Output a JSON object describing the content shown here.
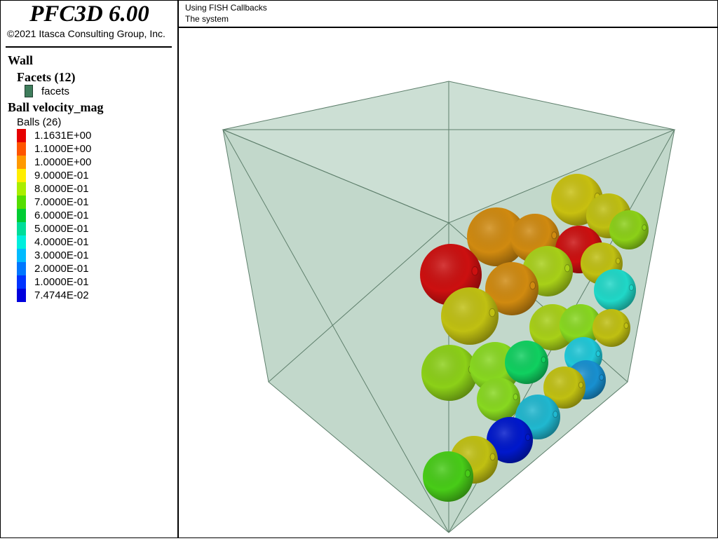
{
  "app": {
    "title": "PFC3D 6.00",
    "copyright": "©2021 Itasca Consulting Group, Inc."
  },
  "legend": {
    "wall_heading": "Wall",
    "facets_heading": "Facets (12)",
    "facet_label": "facets",
    "facet_color": "#3f7d5c",
    "ball_heading": "Ball velocity_mag",
    "balls_count": "Balls (26)",
    "scale": [
      {
        "label": "1.1631E+00",
        "color": "#e60000"
      },
      {
        "label": "1.1000E+00",
        "color": "#ff5500"
      },
      {
        "label": "1.0000E+00",
        "color": "#ff9900"
      },
      {
        "label": "9.0000E-01",
        "color": "#ffee00"
      },
      {
        "label": "8.0000E-01",
        "color": "#aaee00"
      },
      {
        "label": "7.0000E-01",
        "color": "#55dd00"
      },
      {
        "label": "6.0000E-01",
        "color": "#00cc33"
      },
      {
        "label": "5.0000E-01",
        "color": "#00dd99"
      },
      {
        "label": "4.0000E-01",
        "color": "#00eedd"
      },
      {
        "label": "3.0000E-01",
        "color": "#00bbff"
      },
      {
        "label": "2.0000E-01",
        "color": "#0077ff"
      },
      {
        "label": "1.0000E-01",
        "color": "#0033ff"
      },
      {
        "label": "7.4744E-02",
        "color": "#0000dd"
      }
    ]
  },
  "header": {
    "line1": "Using FISH Callbacks",
    "line2": "The system"
  },
  "wall_color": "#8fb8a0"
}
